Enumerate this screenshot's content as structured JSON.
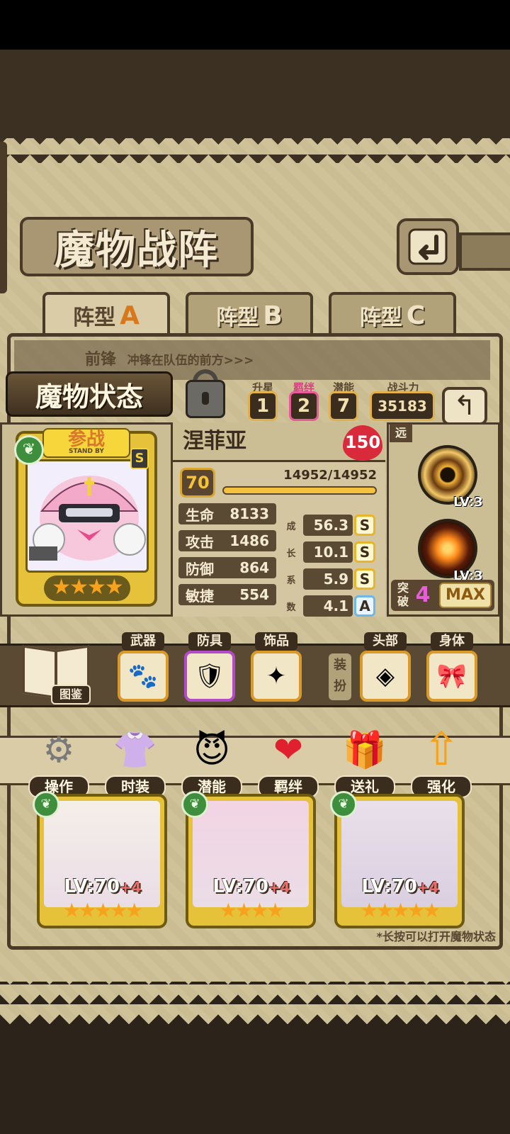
{
  "screen_title": "魔物战阵",
  "formation_tabs": [
    {
      "label": "阵型",
      "letter": "A",
      "active": true
    },
    {
      "label": "阵型",
      "letter": "B",
      "active": false
    },
    {
      "label": "阵型",
      "letter": "C",
      "active": false
    }
  ],
  "vanguard_banner": {
    "title": "前锋",
    "subtitle": "冲锋在队伍的前方>>>"
  },
  "status_panel_title": "魔物状态",
  "top_stats": [
    {
      "label": "升星",
      "value": "1"
    },
    {
      "label": "羁绊",
      "value": "2"
    },
    {
      "label": "潜能",
      "value": "7"
    },
    {
      "label": "战斗力",
      "value": "35183"
    }
  ],
  "monster": {
    "standby_badge": "参战",
    "standby_sub": "STAND BY",
    "rank": "S",
    "stars": "★★★★",
    "name": "涅菲亚",
    "likability": "150",
    "level": "70",
    "exp_text": "14952/14952",
    "exp_fraction": 1.0,
    "range": "远",
    "stats": [
      {
        "label": "生命",
        "value": "8133",
        "growth": "56.3",
        "grade": "S"
      },
      {
        "label": "攻击",
        "value": "1486",
        "growth": "10.1",
        "grade": "S"
      },
      {
        "label": "防御",
        "value": "864",
        "growth": "5.9",
        "grade": "S"
      },
      {
        "label": "敏捷",
        "value": "554",
        "growth": "4.1",
        "grade": "A"
      }
    ],
    "growth_label_chars": [
      "成",
      "长",
      "系",
      "数"
    ],
    "skills": [
      {
        "level": "LV:3",
        "icon": "vortex-skill-icon"
      },
      {
        "level": "LV:3",
        "icon": "burst-skill-icon"
      }
    ],
    "breakthrough_label": "突破",
    "breakthrough_value": "4",
    "max_label": "MAX"
  },
  "equipment": {
    "codex_label": "图鉴",
    "slots": [
      {
        "label": "武器",
        "icon": "paw-weapon-icon",
        "glyph": "🐾"
      },
      {
        "label": "防具",
        "icon": "armor-icon",
        "glyph": "🛡"
      },
      {
        "label": "饰品",
        "icon": "accessory-icon",
        "glyph": "✦"
      }
    ],
    "dress_label": "装扮",
    "cosmetics": [
      {
        "label": "头部",
        "icon": "mask-icon",
        "glyph": "◈"
      },
      {
        "label": "身体",
        "icon": "bow-icon",
        "glyph": "🎀"
      }
    ]
  },
  "actions": [
    {
      "label": "操作",
      "icon": "gear-icon",
      "glyph": "⚙"
    },
    {
      "label": "时装",
      "icon": "outfit-icon",
      "glyph": "👚"
    },
    {
      "label": "潜能",
      "icon": "potential-icon",
      "glyph": "😈"
    },
    {
      "label": "羁绊",
      "icon": "hearts-icon",
      "glyph": "❤"
    },
    {
      "label": "送礼",
      "icon": "gift-icon",
      "glyph": "🎁"
    },
    {
      "label": "强化",
      "icon": "upgrade-arrows-icon",
      "glyph": "⇧"
    }
  ],
  "team": [
    {
      "level": "LV:70",
      "plus": "+4",
      "stars": "★★★★★"
    },
    {
      "level": "LV:70",
      "plus": "+4",
      "stars": "★★★★"
    },
    {
      "level": "LV:70",
      "plus": "+4",
      "stars": "★★★★★"
    }
  ],
  "hint": "*长按可以打开魔物状态",
  "colors": {
    "panel": "#cfc299",
    "frame": "#4a3b28",
    "gold": "#e6c23a",
    "accent": "#d8781c"
  }
}
